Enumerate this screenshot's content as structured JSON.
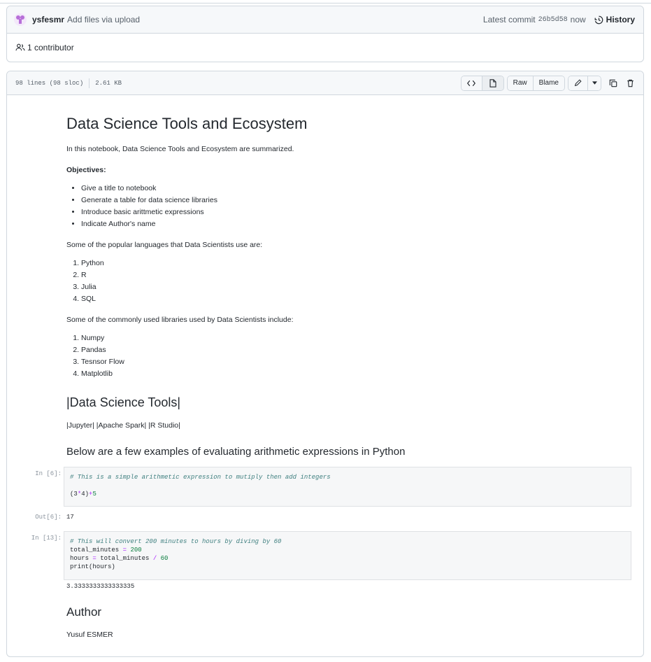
{
  "commit": {
    "author": "ysfesmr",
    "message": "Add files via upload",
    "latest_label": "Latest commit",
    "sha": "26b5d58",
    "when": "now",
    "history_label": "History",
    "contributors": "1 contributor"
  },
  "file": {
    "lines": "98 lines (98 sloc)",
    "size": "2.61 KB",
    "raw_label": "Raw",
    "blame_label": "Blame"
  },
  "notebook": {
    "title": "Data Science Tools and Ecosystem",
    "intro": "In this notebook, Data Science Tools and Ecosystem are summarized.",
    "objectives_label": "Objectives:",
    "objectives": [
      "Give a title to notebook",
      "Generate a table for data science libraries",
      "Introduce basic arittmetic expressions",
      "Indicate Author's name"
    ],
    "languages_intro": "Some of the popular languages that Data Scientists use are:",
    "languages": [
      "Python",
      "R",
      "Julia",
      "SQL"
    ],
    "libraries_intro": "Some of the commonly used libraries used by Data Scientists include:",
    "libraries": [
      "Numpy",
      "Pandas",
      "Tesnsor Flow",
      "Matplotlib"
    ],
    "tools_heading": "|Data Science Tools|",
    "tools_row": "|Jupyter| |Apache Spark| |R Studio|",
    "arith_heading": "Below are a few examples of evaluating arithmetic expressions in Python",
    "cell1": {
      "prompt": "In [6]:",
      "comment": "# This is a simple arithmetic expression to mutiply then add integers",
      "code_a": "(3",
      "code_op1": "*",
      "code_b": "4)",
      "code_op2": "+",
      "code_c": "5",
      "out_prompt": "Out[6]:",
      "output": "17"
    },
    "cell2": {
      "prompt": "In [13]:",
      "comment": "# This will convert 200 minutes to hours by diving by 60",
      "line1_var": "total_minutes ",
      "line1_op": "=",
      "line1_num": "200",
      "line2_var": "hours ",
      "line2_op": "=",
      "line2_mid": " total_minutes ",
      "line2_op2": "/",
      "line2_num": "60",
      "line3": "print(hours)",
      "output": "3.3333333333333335"
    },
    "author_heading": "Author",
    "author_name": "Yusuf ESMER"
  },
  "colors": {
    "border": "#d0d7de",
    "header_bg": "#f6f8fa",
    "avatar": "#b76fd8"
  }
}
